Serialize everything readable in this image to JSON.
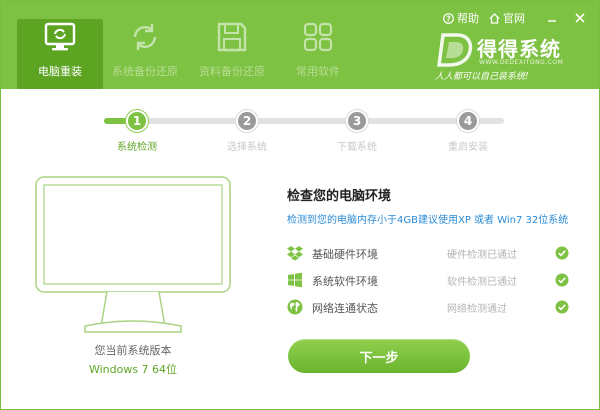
{
  "header": {
    "tabs": [
      {
        "label": "电脑重装",
        "icon": "monitor-reinstall-icon",
        "active": true
      },
      {
        "label": "系统备份还原",
        "icon": "refresh-icon",
        "active": false
      },
      {
        "label": "资料备份还原",
        "icon": "save-icon",
        "active": false
      },
      {
        "label": "常用软件",
        "icon": "apps-grid-icon",
        "active": false
      }
    ],
    "help_label": "帮助",
    "site_label": "官网",
    "brand": {
      "name": "得得系统",
      "url": "WWW.DEDEXITONG.COM",
      "slogan": "人人都可以自己装系统!"
    }
  },
  "steps": [
    {
      "number": "1",
      "label": "系统检测",
      "state": "current"
    },
    {
      "number": "2",
      "label": "选择系统",
      "state": "pending"
    },
    {
      "number": "3",
      "label": "下载系统",
      "state": "pending"
    },
    {
      "number": "4",
      "label": "重启安装",
      "state": "pending"
    }
  ],
  "current_system": {
    "caption": "您当前系统版本",
    "value": "Windows 7 64位"
  },
  "check": {
    "title": "检查您的电脑环境",
    "note": "检测到您的电脑内存小于4GB建议使用XP 或者 Win7 32位系统",
    "items": [
      {
        "name": "基础硬件环境",
        "status": "硬件检测已通过",
        "icon": "dropbox-icon"
      },
      {
        "name": "系统软件环境",
        "status": "软件检测已通过",
        "icon": "windows-logo-icon"
      },
      {
        "name": "网络连通状态",
        "status": "网络检测通过",
        "icon": "globe-icon"
      }
    ]
  },
  "next_button_label": "下一步",
  "colors": {
    "brand_green": "#7dc242",
    "active_tab": "#5da423",
    "note_blue": "#2a8bd6"
  }
}
